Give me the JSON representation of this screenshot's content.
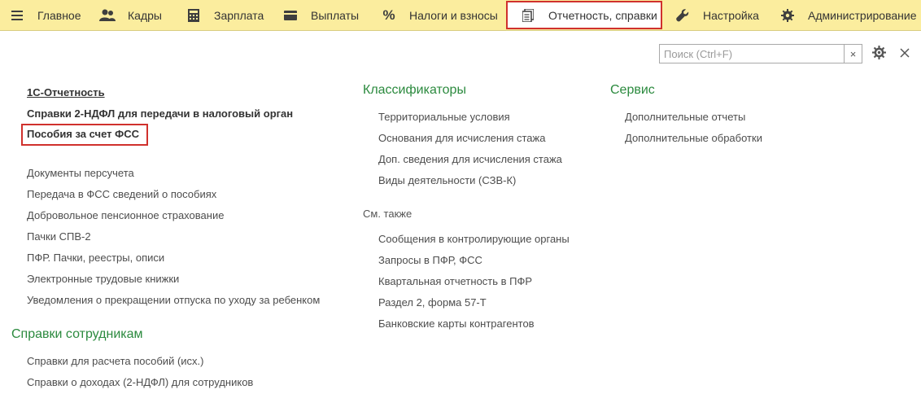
{
  "menu": {
    "items": [
      {
        "label": "Главное",
        "icon": "hamburger-icon"
      },
      {
        "label": "Кадры",
        "icon": "users-icon"
      },
      {
        "label": "Зарплата",
        "icon": "calculator-icon"
      },
      {
        "label": "Выплаты",
        "icon": "wallet-icon"
      },
      {
        "label": "Налоги и взносы",
        "icon": "percent-icon"
      },
      {
        "label": "Отчетность, справки",
        "icon": "documents-icon",
        "active": true
      },
      {
        "label": "Настройка",
        "icon": "wrench-icon"
      },
      {
        "label": "Администрирование",
        "icon": "gear-icon"
      }
    ]
  },
  "toolbar": {
    "search_placeholder": "Поиск (Ctrl+F)",
    "clear_label": "×"
  },
  "left": {
    "top_links": [
      "1С-Отчетность",
      "Справки 2-НДФЛ для передачи в налоговый орган",
      "Пособия за счет ФСС"
    ],
    "links": [
      "Документы персучета",
      "Передача в ФСС сведений о пособиях",
      "Добровольное пенсионное страхование",
      "Пачки СПВ-2",
      "ПФР. Пачки, реестры, описи",
      "Электронные трудовые книжки",
      "Уведомления о прекращении отпуска по уходу за ребенком"
    ],
    "employees_heading": "Справки сотрудникам",
    "employees_links": [
      "Справки для расчета пособий (исх.)",
      "Справки о доходах (2-НДФЛ) для сотрудников"
    ]
  },
  "middle": {
    "heading": "Классификаторы",
    "links": [
      "Территориальные условия",
      "Основания для исчисления стажа",
      "Доп. сведения для исчисления стажа",
      "Виды деятельности (СЗВ-К)"
    ],
    "see_also_heading": "См. также",
    "see_also_links": [
      "Сообщения в контролирующие органы",
      "Запросы в ПФР, ФСС",
      "Квартальная отчетность в ПФР",
      "Раздел 2, форма 57-Т",
      "Банковские карты контрагентов"
    ]
  },
  "right": {
    "heading": "Сервис",
    "links": [
      "Дополнительные отчеты",
      "Дополнительные обработки"
    ]
  },
  "colors": {
    "menubar_bg": "#fbed9e",
    "heading_green": "#2b8a3e",
    "highlight_red": "#d0312d"
  }
}
